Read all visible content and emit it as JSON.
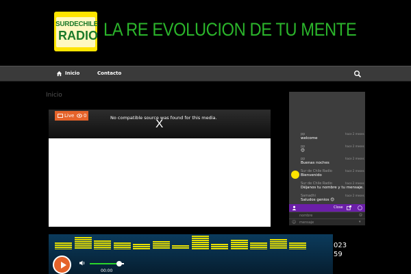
{
  "header": {
    "logo_top": "SURDECHILE",
    "logo_bottom": "RADIO",
    "slogan": "LA RE EVOLUCION DE TU MENTE"
  },
  "nav": {
    "items": [
      {
        "label": "Inicio",
        "icon": "home-icon"
      },
      {
        "label": "Contacto"
      }
    ],
    "search_icon": "search-icon"
  },
  "breadcrumb": "Inicio",
  "player": {
    "live_label": "Live",
    "views_count": "0",
    "message": "No compatible source was found for this media.",
    "close_label": "X"
  },
  "chat": {
    "messages": [
      {
        "name": "pp",
        "time": "hace 2 meses",
        "text": "welcome"
      },
      {
        "name": "pp",
        "time": "hace 2 meses",
        "text": "😊"
      },
      {
        "name": "pp",
        "time": "hace 2 meses",
        "text": "Buenas noches"
      },
      {
        "name": "Sur de Chile Radio",
        "time": "hace 2 meses",
        "text": "Bienvenido"
      },
      {
        "name": "Sur de Chile Radio",
        "time": "hace 2 meses",
        "text": "Déjanos tu nombre y tu mensaje."
      },
      {
        "name": "Samadhi",
        "time": "hace 2 meses",
        "text": "Saludos genios 😊"
      }
    ],
    "close_label": "Close",
    "name_placeholder": "nombre",
    "message_placeholder": "mensaje"
  },
  "radio": {
    "time": "00:00",
    "volume": 0.85
  },
  "side_numbers": [
    "023",
    "59"
  ],
  "colors": {
    "accent": "#e5632a",
    "slogan": "#2bb52b",
    "chat_bar": "#6b1fa8"
  }
}
